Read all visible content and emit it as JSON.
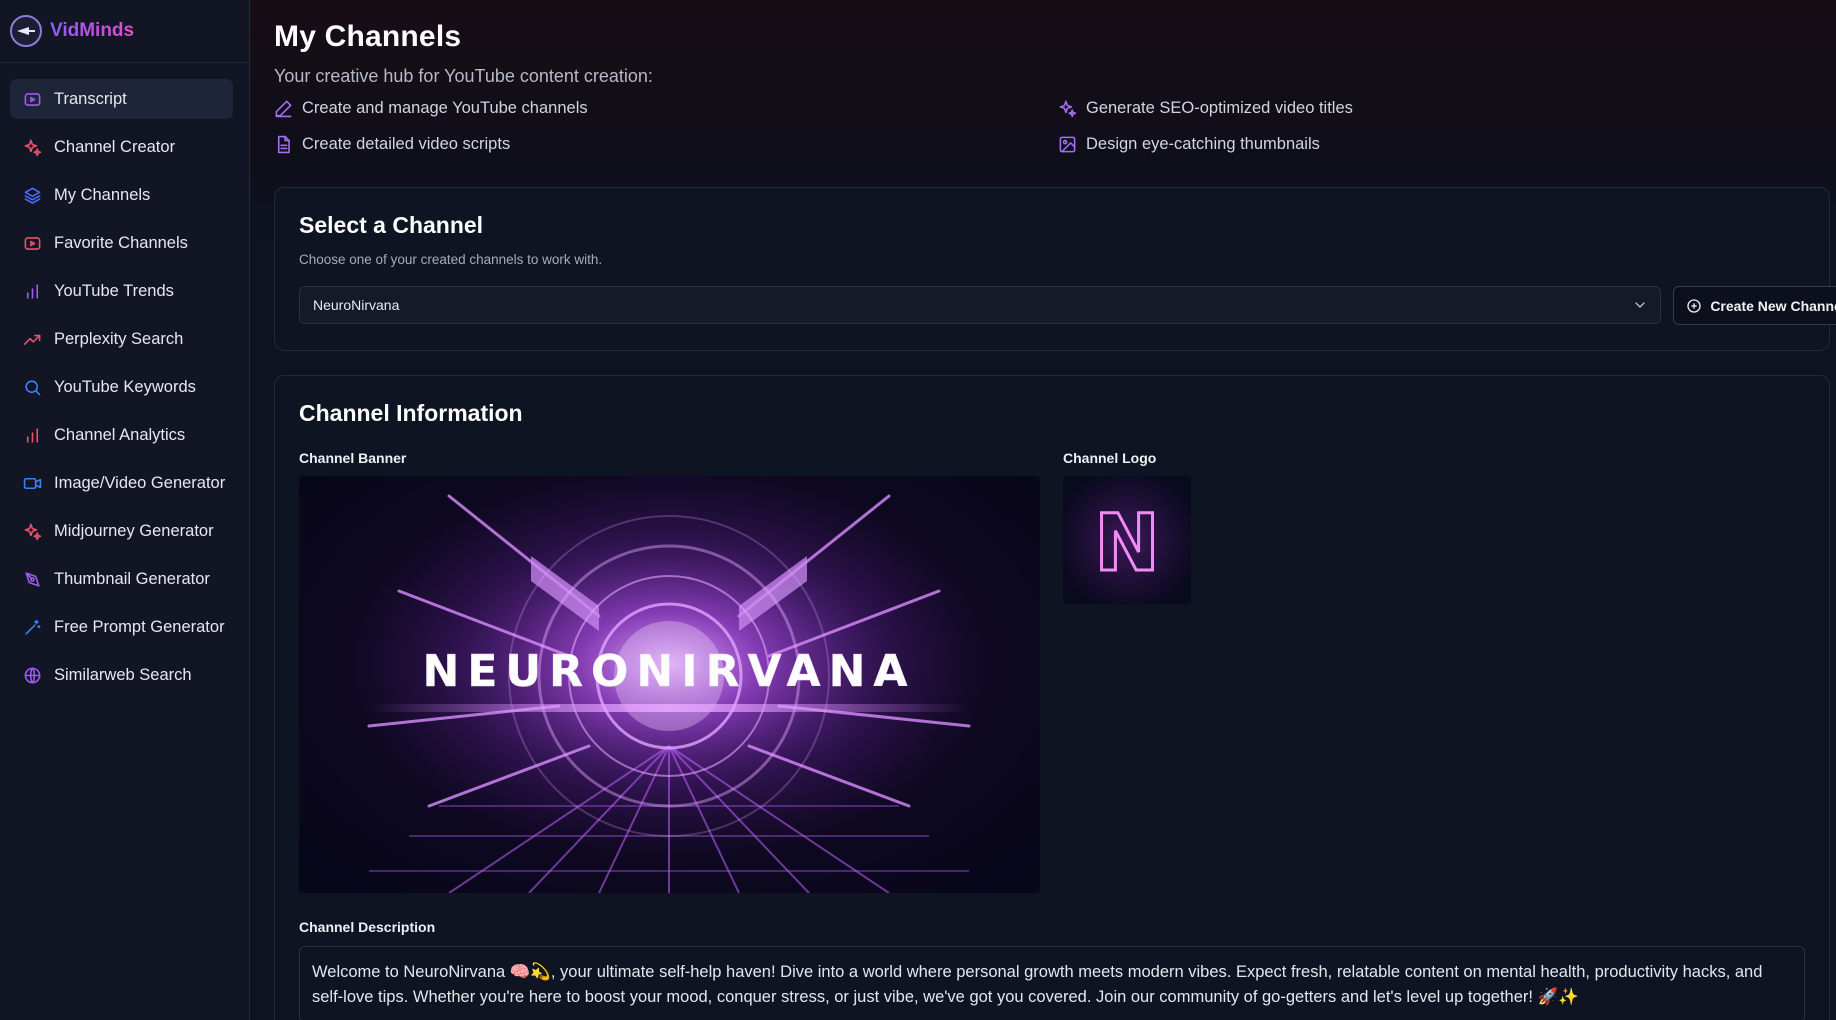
{
  "brand": {
    "name": "VidMinds"
  },
  "sidebar": {
    "items": [
      {
        "label": "Transcript",
        "icon": "play-square-icon",
        "color": "#9b5cf6",
        "active": true
      },
      {
        "label": "Channel Creator",
        "icon": "sparkles-icon",
        "color": "#f0506e"
      },
      {
        "label": "My Channels",
        "icon": "layers-icon",
        "color": "#4f6bff"
      },
      {
        "label": "Favorite Channels",
        "icon": "tv-icon",
        "color": "#f0506e"
      },
      {
        "label": "YouTube Trends",
        "icon": "bar-chart-icon",
        "color": "#9b5cf6"
      },
      {
        "label": "Perplexity Search",
        "icon": "trending-up-icon",
        "color": "#f0506e"
      },
      {
        "label": "YouTube Keywords",
        "icon": "search-icon",
        "color": "#3b82f6"
      },
      {
        "label": "Channel Analytics",
        "icon": "bar-chart-icon",
        "color": "#f0506e"
      },
      {
        "label": "Image/Video Generator",
        "icon": "video-icon",
        "color": "#3b82f6"
      },
      {
        "label": "Midjourney Generator",
        "icon": "sparkles-icon",
        "color": "#f0506e"
      },
      {
        "label": "Thumbnail Generator",
        "icon": "pen-tool-icon",
        "color": "#9b5cf6"
      },
      {
        "label": "Free Prompt Generator",
        "icon": "wand-icon",
        "color": "#3b82f6"
      },
      {
        "label": "Similarweb Search",
        "icon": "globe-icon",
        "color": "#9b5cf6"
      }
    ]
  },
  "header": {
    "title": "My Channels",
    "subtitle": "Your creative hub for YouTube content creation:",
    "features": [
      {
        "label": "Create and manage YouTube channels",
        "icon": "pencil-icon"
      },
      {
        "label": "Generate SEO-optimized video titles",
        "icon": "sparkles-icon"
      },
      {
        "label": "Create detailed video scripts",
        "icon": "file-text-icon"
      },
      {
        "label": "Design eye-catching thumbnails",
        "icon": "image-icon"
      }
    ]
  },
  "select_channel": {
    "title": "Select a Channel",
    "description": "Choose one of your created channels to work with.",
    "selected": "NeuroNirvana",
    "create_button": "Create New Channel"
  },
  "channel_info": {
    "title": "Channel Information",
    "banner_label": "Channel Banner",
    "banner_text": "NEURONIRVANA",
    "logo_label": "Channel Logo",
    "logo_text": "N",
    "description_label": "Channel Description",
    "description": "Welcome to NeuroNirvana 🧠💫, your ultimate self-help haven! Dive into a world where personal growth meets modern vibes. Expect fresh, relatable content on mental health, productivity hacks, and self-love tips. Whether you're here to boost your mood, conquer stress, or just vibe, we've got you covered. Join our community of go-getters and let's level up together! 🚀✨"
  },
  "colors": {
    "accent": "#a56ef0",
    "brand_start": "#8d5cf6",
    "brand_end": "#e24bd0"
  }
}
